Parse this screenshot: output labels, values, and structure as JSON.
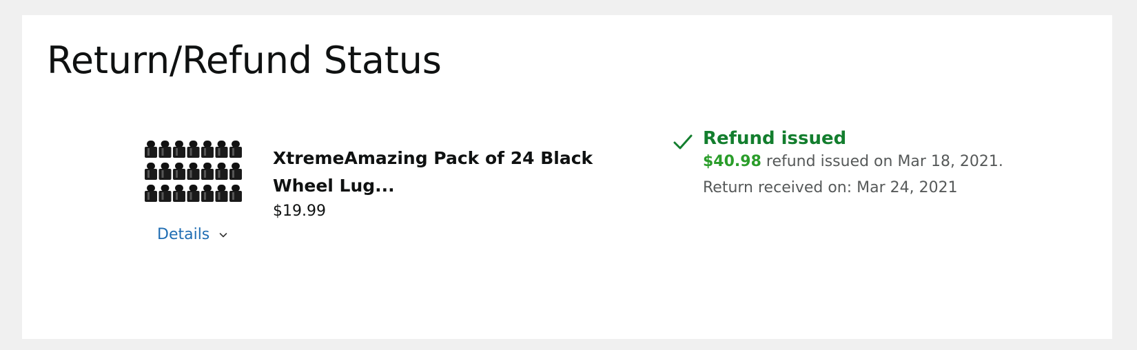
{
  "page": {
    "title": "Return/Refund Status"
  },
  "item": {
    "title": "XtremeAmazing Pack of 24 Black Wheel Lug...",
    "price": "$19.99",
    "details_label": "Details",
    "image": "black-wheel-lug-nuts-image"
  },
  "status": {
    "title": "Refund issued",
    "refund_amount": "$40.98",
    "refund_text": " refund issued on Mar 18, 2021.",
    "return_text": "Return received on: Mar 24, 2021",
    "icon": "check-icon",
    "color": "#137e2e",
    "amount_color": "#2a9d2a"
  },
  "colors": {
    "background": "#f0f0f0",
    "card": "#ffffff",
    "link": "#1f6db3",
    "text": "#0f1111",
    "muted": "#565959"
  }
}
